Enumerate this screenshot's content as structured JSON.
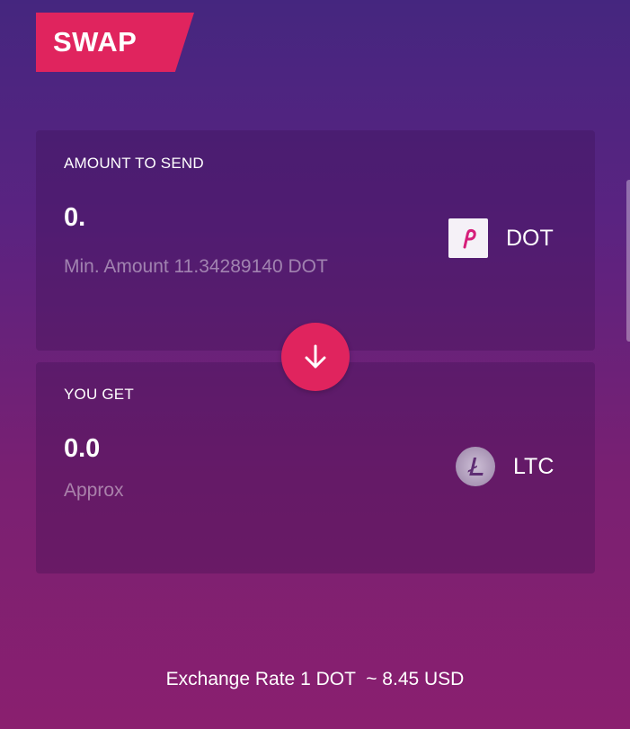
{
  "header": {
    "title": "SWAP"
  },
  "send": {
    "title": "AMOUNT TO SEND",
    "amount": "0.",
    "min_amount": "Min. Amount 11.34289140 DOT",
    "coin": {
      "ticker": "DOT",
      "icon": "polkadot-icon"
    }
  },
  "swap_button": {
    "icon": "arrow-down-icon"
  },
  "get": {
    "title": "YOU GET",
    "amount": "0.0",
    "approx": "Approx",
    "coin": {
      "ticker": "LTC",
      "icon": "litecoin-icon"
    }
  },
  "footer": {
    "exchange_rate": "Exchange Rate 1 DOT  ~ 8.45 USD"
  },
  "colors": {
    "accent": "#e0245e",
    "bg_top": "#45267f",
    "bg_bottom": "#8a1f6f"
  }
}
